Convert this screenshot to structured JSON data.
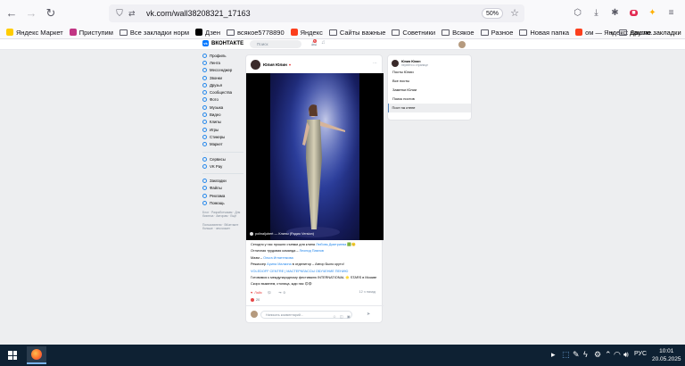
{
  "browser": {
    "url": "vk.com/wall38208321_17163",
    "zoom": "50%",
    "bookmarks": [
      {
        "label": "Яндекс Маркет",
        "type": "site",
        "color": "#ffcc00"
      },
      {
        "label": "Приступим",
        "type": "site",
        "color": "#c13584"
      },
      {
        "label": "Все закладки норм",
        "type": "folder"
      },
      {
        "label": "Дзен",
        "type": "site",
        "color": "#000000"
      },
      {
        "label": "всякое5778890",
        "type": "folder"
      },
      {
        "label": "Яндекс",
        "type": "site",
        "color": "#fc3f1d"
      },
      {
        "label": "Сайты важные",
        "type": "folder"
      },
      {
        "label": "Советники",
        "type": "folder"
      },
      {
        "label": "Всякое",
        "type": "folder"
      },
      {
        "label": "Разное",
        "type": "folder"
      },
      {
        "label": "Новая папка",
        "type": "folder"
      },
      {
        "label": "ом — Яндекс: нашло...",
        "type": "site",
        "color": "#fc3f1d"
      }
    ],
    "bookmarks_more": "Другие закладки"
  },
  "vk": {
    "logo": "ВКОНТАКТЕ",
    "search_placeholder": "Поиск",
    "notifications_badge": "5",
    "menu": [
      {
        "label": "Профиль"
      },
      {
        "label": "Лента"
      },
      {
        "label": "Мессенджер",
        "plus": true
      },
      {
        "label": "Звонки"
      },
      {
        "label": "Друзья"
      },
      {
        "label": "Сообщества"
      },
      {
        "label": "Фото"
      },
      {
        "label": "Музыка"
      },
      {
        "label": "Видео"
      },
      {
        "label": "Клипы"
      },
      {
        "label": "Игры",
        "plus": true
      },
      {
        "label": "Стикеры"
      },
      {
        "label": "Маркет"
      }
    ],
    "menu2": [
      {
        "label": "Сервисы"
      },
      {
        "label": "VK Pay"
      }
    ],
    "menu3": [
      {
        "label": "Закладки"
      },
      {
        "label": "Файлы"
      },
      {
        "label": "Реклама"
      },
      {
        "label": "Помощь"
      }
    ],
    "footer_links": "Блог · Разработчикам · Для бизнеса · Авторам · Ещё",
    "footer_note": "Пользователи · ВКонтакте больше · чем может"
  },
  "post": {
    "author": "Юлия Юлин",
    "video_track": "polinaljubert — Клипы (Радио Version)",
    "text": [
      {
        "parts": [
          {
            "t": "Сегодня у нас прошли съемки для клипа "
          },
          {
            "t": "Любовь Дмитриева",
            "link": true
          },
          {
            "t": " 🟩🙂"
          }
        ]
      },
      {
        "parts": [
          {
            "t": "Отличная трудовая команда – "
          },
          {
            "t": "Леонид Павлов",
            "link": true
          }
        ]
      },
      {
        "parts": [
          {
            "t": "Маэм – "
          },
          {
            "t": "Ольга Игнатенкова",
            "link": true
          }
        ]
      },
      {
        "parts": [
          {
            "t": "Режиссер "
          },
          {
            "t": "Арина Малкина",
            "link": true
          },
          {
            "t": " в отделитор – Автор Было круто!"
          }
        ]
      },
      {
        "parts": [
          {
            "t": "VOLEDOFF CENTRE | МАСТЕРКЛАССЫ ОБУЧЕНИЕ ПЕНИЮ",
            "link": true
          }
        ]
      },
      {
        "parts": [
          {
            "t": "Готовимся к международному фестивалю INTERNATIONAL 🌟 STARS в Москве"
          }
        ]
      },
      {
        "parts": [
          {
            "t": "Скоро выкинем, столица, жди нас 😊😍"
          }
        ]
      }
    ],
    "time": "12 ч назад",
    "likes": "Лайк",
    "comments": "",
    "reposts": "0",
    "reactions_count": "20",
    "comment_placeholder": "Написать комментарий..."
  },
  "filter": {
    "owner_name": "Юлия Юлин",
    "owner_sub": "перейти к странице",
    "items": [
      {
        "label": "Посты Юлии",
        "active": false
      },
      {
        "label": "Все посты",
        "active": false
      },
      {
        "label": "Заметки Юлии",
        "active": false
      },
      {
        "label": "Поиск постов",
        "active": false
      },
      {
        "label": "Пост на стене",
        "active": true
      }
    ]
  },
  "taskbar": {
    "lang": "РУС",
    "time": "10:01",
    "date": "20.05.2025"
  }
}
